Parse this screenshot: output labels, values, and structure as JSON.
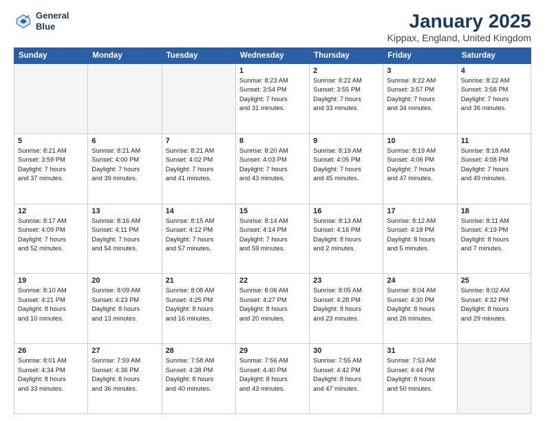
{
  "header": {
    "logo_line1": "General",
    "logo_line2": "Blue",
    "title": "January 2025",
    "subtitle": "Kippax, England, United Kingdom"
  },
  "weekdays": [
    "Sunday",
    "Monday",
    "Tuesday",
    "Wednesday",
    "Thursday",
    "Friday",
    "Saturday"
  ],
  "weeks": [
    [
      {
        "day": "",
        "detail": ""
      },
      {
        "day": "",
        "detail": ""
      },
      {
        "day": "",
        "detail": ""
      },
      {
        "day": "1",
        "detail": "Sunrise: 8:23 AM\nSunset: 3:54 PM\nDaylight: 7 hours\nand 31 minutes."
      },
      {
        "day": "2",
        "detail": "Sunrise: 8:22 AM\nSunset: 3:55 PM\nDaylight: 7 hours\nand 33 minutes."
      },
      {
        "day": "3",
        "detail": "Sunrise: 8:22 AM\nSunset: 3:57 PM\nDaylight: 7 hours\nand 34 minutes."
      },
      {
        "day": "4",
        "detail": "Sunrise: 8:22 AM\nSunset: 3:58 PM\nDaylight: 7 hours\nand 36 minutes."
      }
    ],
    [
      {
        "day": "5",
        "detail": "Sunrise: 8:21 AM\nSunset: 3:59 PM\nDaylight: 7 hours\nand 37 minutes."
      },
      {
        "day": "6",
        "detail": "Sunrise: 8:21 AM\nSunset: 4:00 PM\nDaylight: 7 hours\nand 39 minutes."
      },
      {
        "day": "7",
        "detail": "Sunrise: 8:21 AM\nSunset: 4:02 PM\nDaylight: 7 hours\nand 41 minutes."
      },
      {
        "day": "8",
        "detail": "Sunrise: 8:20 AM\nSunset: 4:03 PM\nDaylight: 7 hours\nand 43 minutes."
      },
      {
        "day": "9",
        "detail": "Sunrise: 8:19 AM\nSunset: 4:05 PM\nDaylight: 7 hours\nand 45 minutes."
      },
      {
        "day": "10",
        "detail": "Sunrise: 8:19 AM\nSunset: 4:06 PM\nDaylight: 7 hours\nand 47 minutes."
      },
      {
        "day": "11",
        "detail": "Sunrise: 8:18 AM\nSunset: 4:08 PM\nDaylight: 7 hours\nand 49 minutes."
      }
    ],
    [
      {
        "day": "12",
        "detail": "Sunrise: 8:17 AM\nSunset: 4:09 PM\nDaylight: 7 hours\nand 52 minutes."
      },
      {
        "day": "13",
        "detail": "Sunrise: 8:16 AM\nSunset: 4:11 PM\nDaylight: 7 hours\nand 54 minutes."
      },
      {
        "day": "14",
        "detail": "Sunrise: 8:15 AM\nSunset: 4:12 PM\nDaylight: 7 hours\nand 57 minutes."
      },
      {
        "day": "15",
        "detail": "Sunrise: 8:14 AM\nSunset: 4:14 PM\nDaylight: 7 hours\nand 59 minutes."
      },
      {
        "day": "16",
        "detail": "Sunrise: 8:13 AM\nSunset: 4:16 PM\nDaylight: 8 hours\nand 2 minutes."
      },
      {
        "day": "17",
        "detail": "Sunrise: 8:12 AM\nSunset: 4:18 PM\nDaylight: 8 hours\nand 5 minutes."
      },
      {
        "day": "18",
        "detail": "Sunrise: 8:11 AM\nSunset: 4:19 PM\nDaylight: 8 hours\nand 7 minutes."
      }
    ],
    [
      {
        "day": "19",
        "detail": "Sunrise: 8:10 AM\nSunset: 4:21 PM\nDaylight: 8 hours\nand 10 minutes."
      },
      {
        "day": "20",
        "detail": "Sunrise: 8:09 AM\nSunset: 4:23 PM\nDaylight: 8 hours\nand 13 minutes."
      },
      {
        "day": "21",
        "detail": "Sunrise: 8:08 AM\nSunset: 4:25 PM\nDaylight: 8 hours\nand 16 minutes."
      },
      {
        "day": "22",
        "detail": "Sunrise: 8:06 AM\nSunset: 4:27 PM\nDaylight: 8 hours\nand 20 minutes."
      },
      {
        "day": "23",
        "detail": "Sunrise: 8:05 AM\nSunset: 4:28 PM\nDaylight: 8 hours\nand 23 minutes."
      },
      {
        "day": "24",
        "detail": "Sunrise: 8:04 AM\nSunset: 4:30 PM\nDaylight: 8 hours\nand 26 minutes."
      },
      {
        "day": "25",
        "detail": "Sunrise: 8:02 AM\nSunset: 4:32 PM\nDaylight: 8 hours\nand 29 minutes."
      }
    ],
    [
      {
        "day": "26",
        "detail": "Sunrise: 8:01 AM\nSunset: 4:34 PM\nDaylight: 8 hours\nand 33 minutes."
      },
      {
        "day": "27",
        "detail": "Sunrise: 7:59 AM\nSunset: 4:36 PM\nDaylight: 8 hours\nand 36 minutes."
      },
      {
        "day": "28",
        "detail": "Sunrise: 7:58 AM\nSunset: 4:38 PM\nDaylight: 8 hours\nand 40 minutes."
      },
      {
        "day": "29",
        "detail": "Sunrise: 7:56 AM\nSunset: 4:40 PM\nDaylight: 8 hours\nand 43 minutes."
      },
      {
        "day": "30",
        "detail": "Sunrise: 7:55 AM\nSunset: 4:42 PM\nDaylight: 8 hours\nand 47 minutes."
      },
      {
        "day": "31",
        "detail": "Sunrise: 7:53 AM\nSunset: 4:44 PM\nDaylight: 8 hours\nand 50 minutes."
      },
      {
        "day": "",
        "detail": ""
      }
    ]
  ]
}
